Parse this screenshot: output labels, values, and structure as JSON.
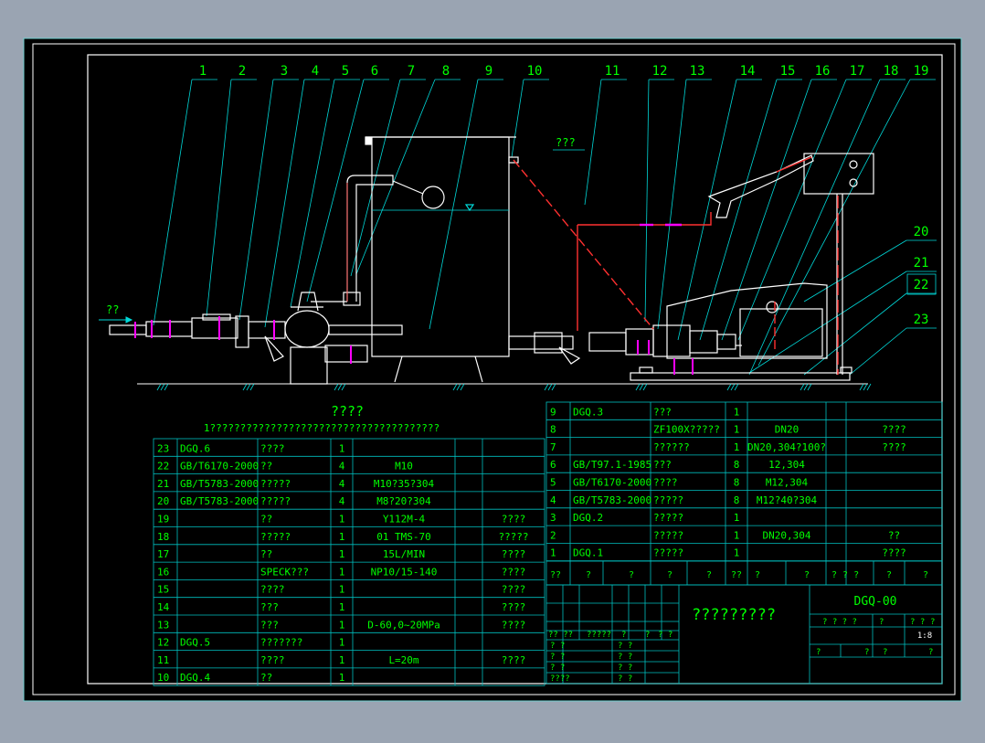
{
  "colors": {
    "background": "#9aa4b2",
    "canvas": "#000000",
    "frame": "#ffffff",
    "table_line": "#00c0c0",
    "text_green": "#00ff00",
    "text_yellow": "#ffff00",
    "pipe_red": "#ff3030",
    "magenta": "#ff00ff",
    "leader_cyan": "#00d8d8"
  },
  "callouts": [
    "1",
    "2",
    "3",
    "4",
    "5",
    "6",
    "7",
    "8",
    "9",
    "10",
    "11",
    "12",
    "13",
    "14",
    "15",
    "16",
    "17",
    "18",
    "19",
    "20",
    "21",
    "22",
    "23"
  ],
  "annotations": {
    "inlet": "??",
    "pipe_note": "???"
  },
  "parts_list": {
    "title": "????",
    "note": "1??????????????????????????????????????",
    "left_rows": [
      [
        "23",
        "DGQ.6",
        "????",
        "1",
        "",
        "",
        ""
      ],
      [
        "22",
        "GB/T6170-2000",
        "??",
        "4",
        "M10",
        "",
        ""
      ],
      [
        "21",
        "GB/T5783-2000",
        "?????",
        "4",
        "M10?35?304",
        "",
        ""
      ],
      [
        "20",
        "GB/T5783-2000",
        "?????",
        "4",
        "M8?20?304",
        "",
        ""
      ],
      [
        "19",
        "",
        "??",
        "1",
        "Y112M-4",
        "",
        "????"
      ],
      [
        "18",
        "",
        "?????",
        "1",
        "01 TMS-70",
        "",
        "?????"
      ],
      [
        "17",
        "",
        "??",
        "1",
        "15L/MIN",
        "",
        "????"
      ],
      [
        "16",
        "",
        "SPECK???",
        "1",
        "NP10/15-140",
        "",
        "????"
      ],
      [
        "15",
        "",
        "????",
        "1",
        "",
        "",
        "????"
      ],
      [
        "14",
        "",
        "???",
        "1",
        "",
        "",
        "????"
      ],
      [
        "13",
        "",
        "???",
        "1",
        "D-60,0~20MPa",
        "",
        "????"
      ],
      [
        "12",
        "DGQ.5",
        "???????",
        "1",
        "",
        "",
        ""
      ],
      [
        "11",
        "",
        "????",
        "1",
        "L=20m",
        "",
        "????"
      ],
      [
        "10",
        "DGQ.4",
        "??",
        "1",
        "",
        "",
        ""
      ]
    ],
    "right_rows": [
      [
        "9",
        "DGQ.3",
        "???",
        "1",
        "",
        "",
        ""
      ],
      [
        "8",
        "",
        "ZF100X?????",
        "1",
        "DN20",
        "",
        "????"
      ],
      [
        "7",
        "",
        "??????",
        "1",
        "DN20,304?100?",
        "",
        "????"
      ],
      [
        "6",
        "GB/T97.1-1985",
        "???",
        "8",
        "12,304",
        "",
        ""
      ],
      [
        "5",
        "GB/T6170-2000",
        "????",
        "8",
        "M12,304",
        "",
        ""
      ],
      [
        "4",
        "GB/T5783-2000",
        "?????",
        "8",
        "M12?40?304",
        "",
        ""
      ],
      [
        "3",
        "DGQ.2",
        "?????",
        "1",
        "",
        "",
        ""
      ],
      [
        "2",
        "",
        "?????",
        "1",
        "DN20,304",
        "",
        "??"
      ],
      [
        "1",
        "DGQ.1",
        "?????",
        "1",
        "",
        "",
        "????"
      ]
    ],
    "header": [
      "??",
      "?",
      "?",
      "?",
      "?",
      "??",
      "?",
      "?",
      "? ? ?",
      "?",
      "?"
    ]
  },
  "title_block": {
    "drawing_title": "?????????",
    "drawing_no": "DGQ-00",
    "scale": "1:8",
    "sign_labels": [
      "?? ??",
      "?????",
      "?",
      "?",
      "? ?"
    ],
    "sign_rows": [
      "? ?",
      "? ?",
      "? ?",
      "????"
    ],
    "sign_right": [
      "? ?",
      "? ?",
      "? ?",
      "? ?"
    ],
    "sheet_row": [
      "? ? ? ?",
      "?",
      "? ?",
      "?"
    ],
    "sheet_row2": [
      "?",
      "?",
      "?",
      "?"
    ]
  }
}
